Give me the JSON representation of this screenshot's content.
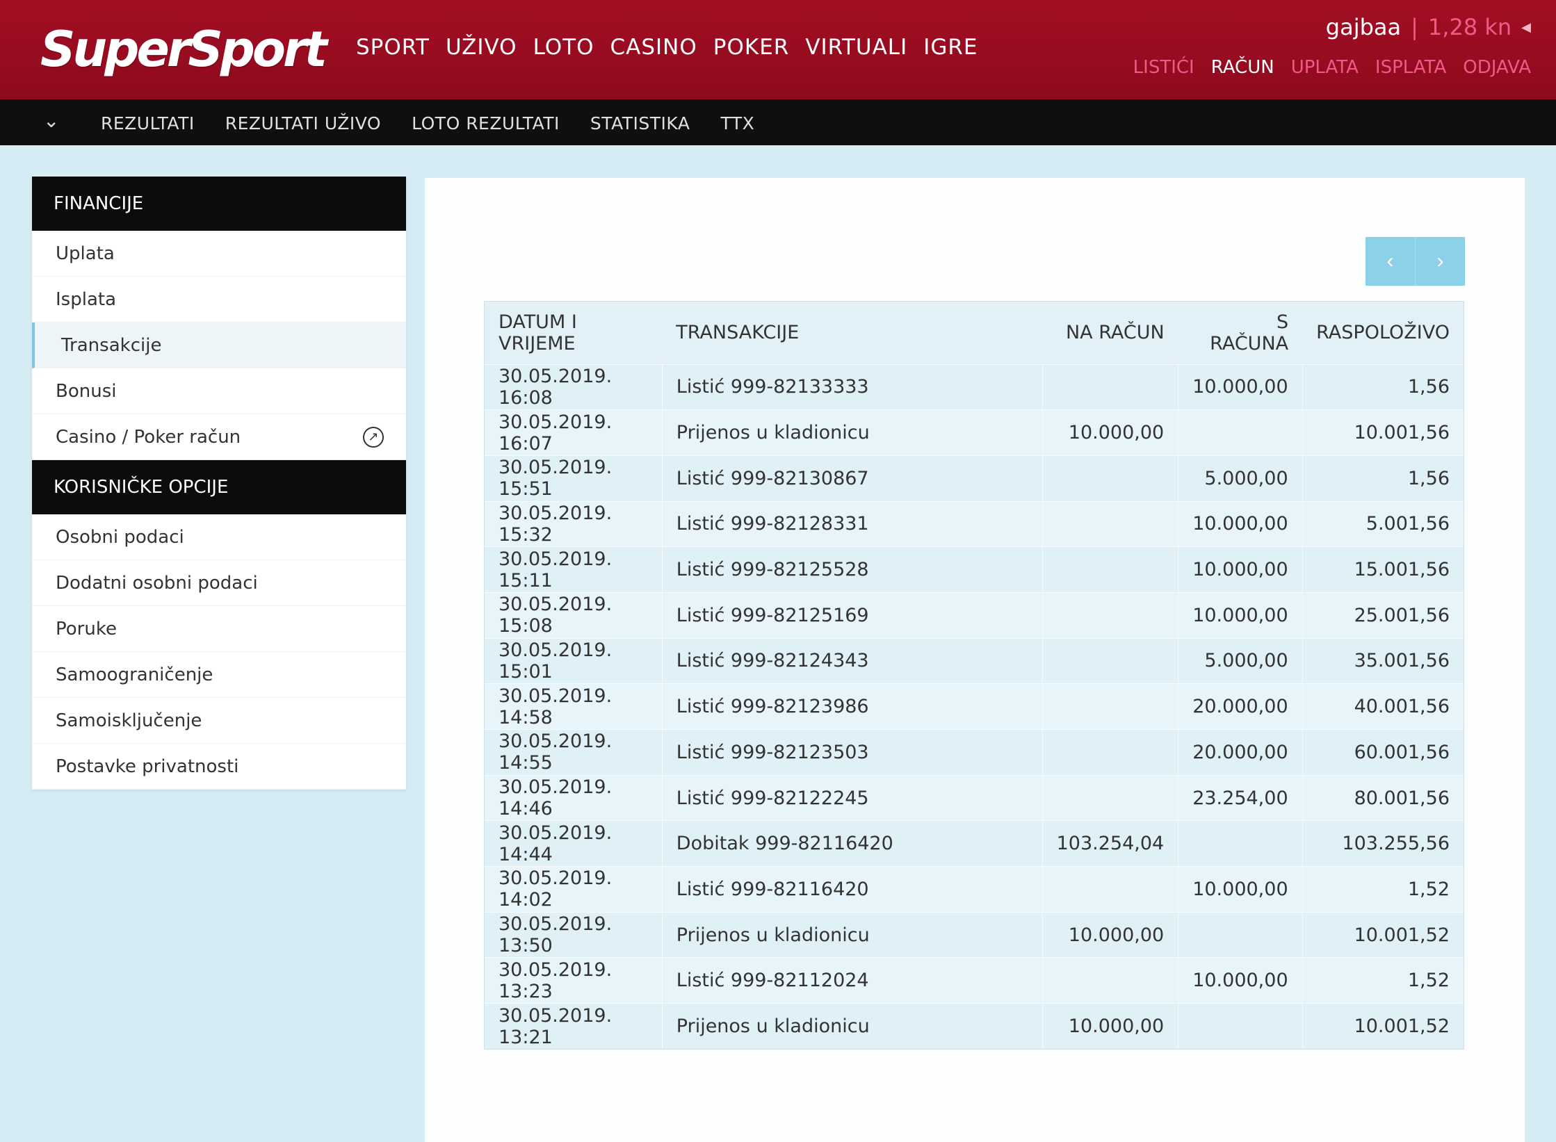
{
  "header": {
    "logo": "SuperSport",
    "main_nav": [
      "SPORT",
      "UŽIVO",
      "LOTO",
      "CASINO",
      "POKER",
      "VIRTUALI",
      "IGRE"
    ],
    "username": "gajbaa",
    "separator": "|",
    "balance": "1,28 kn",
    "account_nav": [
      {
        "label": "LISTIĆI",
        "color": "#ef5a86"
      },
      {
        "label": "RAČUN",
        "color": "#ffffff"
      },
      {
        "label": "UPLATA",
        "color": "#ef5a86"
      },
      {
        "label": "ISPLATA",
        "color": "#ef5a86"
      },
      {
        "label": "ODJAVA",
        "color": "#ef5a86"
      }
    ],
    "brand_color": "#a30e24"
  },
  "sub_nav": [
    "REZULTATI",
    "REZULTATI UŽIVO",
    "LOTO REZULTATI",
    "STATISTIKA",
    "TTX"
  ],
  "sidebar": {
    "sections": [
      {
        "title": "FINANCIJE",
        "items": [
          {
            "label": "Uplata"
          },
          {
            "label": "Isplata"
          },
          {
            "label": "Transakcije",
            "active": true
          },
          {
            "label": "Bonusi"
          },
          {
            "label": "Casino / Poker račun",
            "icon": "external-link-icon"
          }
        ]
      },
      {
        "title": "KORISNIČKE OPCIJE",
        "items": [
          {
            "label": "Osobni podaci"
          },
          {
            "label": "Dodatni osobni podaci"
          },
          {
            "label": "Poruke"
          },
          {
            "label": "Samoograničenje"
          },
          {
            "label": "Samoisključenje"
          },
          {
            "label": "Postavke privatnosti"
          }
        ]
      }
    ]
  },
  "pager": {
    "prev": "‹",
    "next": "›",
    "color": "#8dd0ea"
  },
  "transactions": {
    "headers": [
      "DATUM I VRIJEME",
      "TRANSAKCIJE",
      "NA RAČUN",
      "S RAČUNA",
      "RASPOLOŽIVO"
    ],
    "rows": [
      [
        "30.05.2019. 16:08",
        "Listić 999-82133333",
        "",
        "10.000,00",
        "1,56"
      ],
      [
        "30.05.2019. 16:07",
        "Prijenos u kladionicu",
        "10.000,00",
        "",
        "10.001,56"
      ],
      [
        "30.05.2019. 15:51",
        "Listić 999-82130867",
        "",
        "5.000,00",
        "1,56"
      ],
      [
        "30.05.2019. 15:32",
        "Listić 999-82128331",
        "",
        "10.000,00",
        "5.001,56"
      ],
      [
        "30.05.2019. 15:11",
        "Listić 999-82125528",
        "",
        "10.000,00",
        "15.001,56"
      ],
      [
        "30.05.2019. 15:08",
        "Listić 999-82125169",
        "",
        "10.000,00",
        "25.001,56"
      ],
      [
        "30.05.2019. 15:01",
        "Listić 999-82124343",
        "",
        "5.000,00",
        "35.001,56"
      ],
      [
        "30.05.2019. 14:58",
        "Listić 999-82123986",
        "",
        "20.000,00",
        "40.001,56"
      ],
      [
        "30.05.2019. 14:55",
        "Listić 999-82123503",
        "",
        "20.000,00",
        "60.001,56"
      ],
      [
        "30.05.2019. 14:46",
        "Listić 999-82122245",
        "",
        "23.254,00",
        "80.001,56"
      ],
      [
        "30.05.2019. 14:44",
        "Dobitak 999-82116420",
        "103.254,04",
        "",
        "103.255,56"
      ],
      [
        "30.05.2019. 14:02",
        "Listić 999-82116420",
        "",
        "10.000,00",
        "1,52"
      ],
      [
        "30.05.2019. 13:50",
        "Prijenos u kladionicu",
        "10.000,00",
        "",
        "10.001,52"
      ],
      [
        "30.05.2019. 13:23",
        "Listić 999-82112024",
        "",
        "10.000,00",
        "1,52"
      ],
      [
        "30.05.2019. 13:21",
        "Prijenos u kladionicu",
        "10.000,00",
        "",
        "10.001,52"
      ]
    ]
  }
}
